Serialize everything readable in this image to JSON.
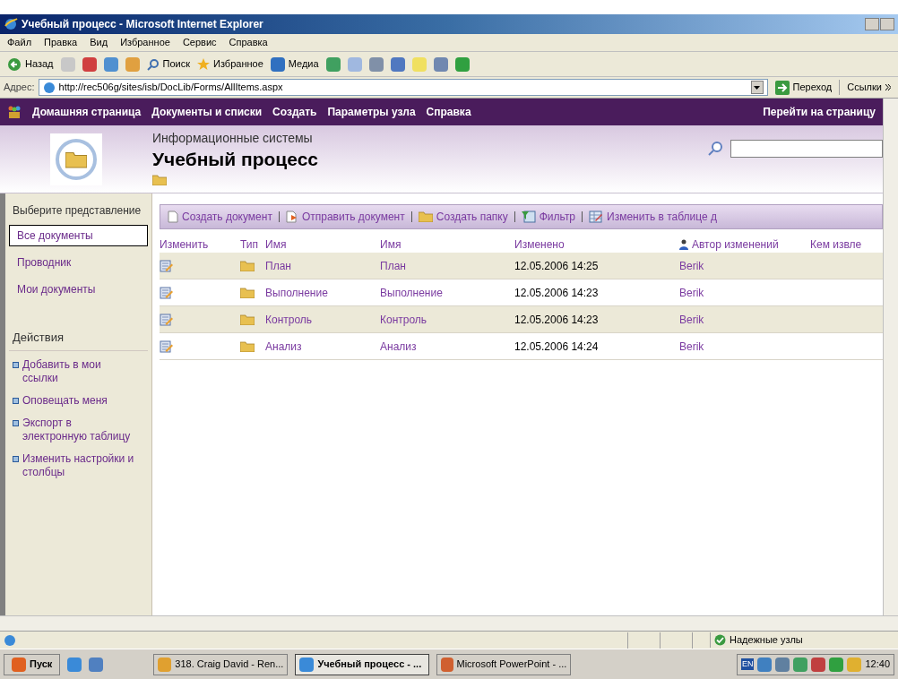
{
  "window": {
    "title": "Учебный процесс - Microsoft Internet Explorer"
  },
  "menu": [
    "Файл",
    "Правка",
    "Вид",
    "Избранное",
    "Сервис",
    "Справка"
  ],
  "toolbar": {
    "back": "Назад",
    "search": "Поиск",
    "favorites": "Избранное",
    "media": "Медиа"
  },
  "address": {
    "label": "Адрес:",
    "value": "http://rec506g/sites/isb/DocLib/Forms/AllItems.aspx",
    "go": "Переход",
    "links": "Ссылки"
  },
  "site_nav": {
    "items": [
      "Домашняя страница",
      "Документы и списки",
      "Создать",
      "Параметры узла",
      "Справка"
    ],
    "goto": "Перейти на страницу"
  },
  "header": {
    "site": "Информационные системы",
    "title": "Учебный процесс"
  },
  "sidebar": {
    "views_heading": "Выберите представление",
    "views": [
      {
        "label": "Все документы",
        "selected": true
      },
      {
        "label": "Проводник",
        "selected": false
      },
      {
        "label": "Мои документы",
        "selected": false
      }
    ],
    "actions_heading": "Действия",
    "actions": [
      "Добавить в мои ссылки",
      "Оповещать меня",
      "Экспорт в электронную таблицу",
      "Изменить настройки и столбцы"
    ]
  },
  "list_toolbar": [
    {
      "kind": "new",
      "label": "Создать документ"
    },
    {
      "kind": "upload",
      "label": "Отправить документ"
    },
    {
      "kind": "folder",
      "label": "Создать папку"
    },
    {
      "kind": "filter",
      "label": "Фильтр"
    },
    {
      "kind": "grid",
      "label": "Изменить в таблице д"
    }
  ],
  "table": {
    "columns": [
      "Изменить",
      "Тип",
      "Имя",
      "Имя",
      "Изменено",
      "Автор изменений",
      "Кем извле"
    ],
    "rows": [
      {
        "name": "План",
        "name_2": "План",
        "modified": "12.05.2006 14:25",
        "author": "Berik"
      },
      {
        "name": "Выполнение",
        "name_2": "Выполнение",
        "modified": "12.05.2006 14:23",
        "author": "Berik"
      },
      {
        "name": "Контроль",
        "name_2": "Контроль",
        "modified": "12.05.2006 14:23",
        "author": "Berik"
      },
      {
        "name": "Анализ",
        "name_2": "Анализ",
        "modified": "12.05.2006 14:24",
        "author": "Berik"
      }
    ]
  },
  "status_bar": {
    "zone": "Надежные узлы"
  },
  "taskbar": {
    "start": "Пуск",
    "tasks": [
      {
        "label": "318. Craig David - Ren...",
        "selected": false
      },
      {
        "label": "Учебный процесс - ...",
        "selected": true
      },
      {
        "label": "Microsoft PowerPoint - ...",
        "selected": false
      }
    ],
    "lang": "EN",
    "clock": "12:40"
  }
}
